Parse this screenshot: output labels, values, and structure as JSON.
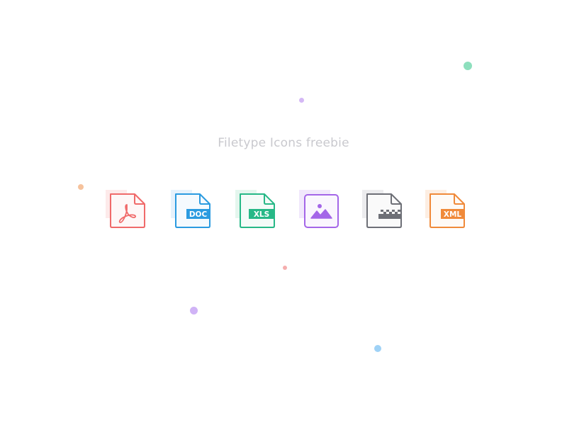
{
  "title": "Filetype Icons freebie",
  "icons": [
    {
      "name": "pdf-icon",
      "label": "",
      "color": "#f06a6a",
      "tint": "#fdeaea"
    },
    {
      "name": "doc-icon",
      "label": "DOC",
      "color": "#2b9be0",
      "tint": "#e6f2fc"
    },
    {
      "name": "xls-icon",
      "label": "XLS",
      "color": "#27b887",
      "tint": "#e4f6ee"
    },
    {
      "name": "image-icon",
      "label": "",
      "color": "#a466e8",
      "tint": "#f1e8fc"
    },
    {
      "name": "zip-icon",
      "label": "",
      "color": "#6e7077",
      "tint": "#ececee"
    },
    {
      "name": "xml-icon",
      "label": "XML",
      "color": "#f08a3a",
      "tint": "#fdeee2"
    }
  ],
  "dot_colors": {
    "green": "#8ddfbd",
    "purple": "#d4b8f5",
    "orange": "#f6c29c",
    "pink": "#f5aeae",
    "violet": "#d0b3f6",
    "blue": "#9fd2f6"
  }
}
